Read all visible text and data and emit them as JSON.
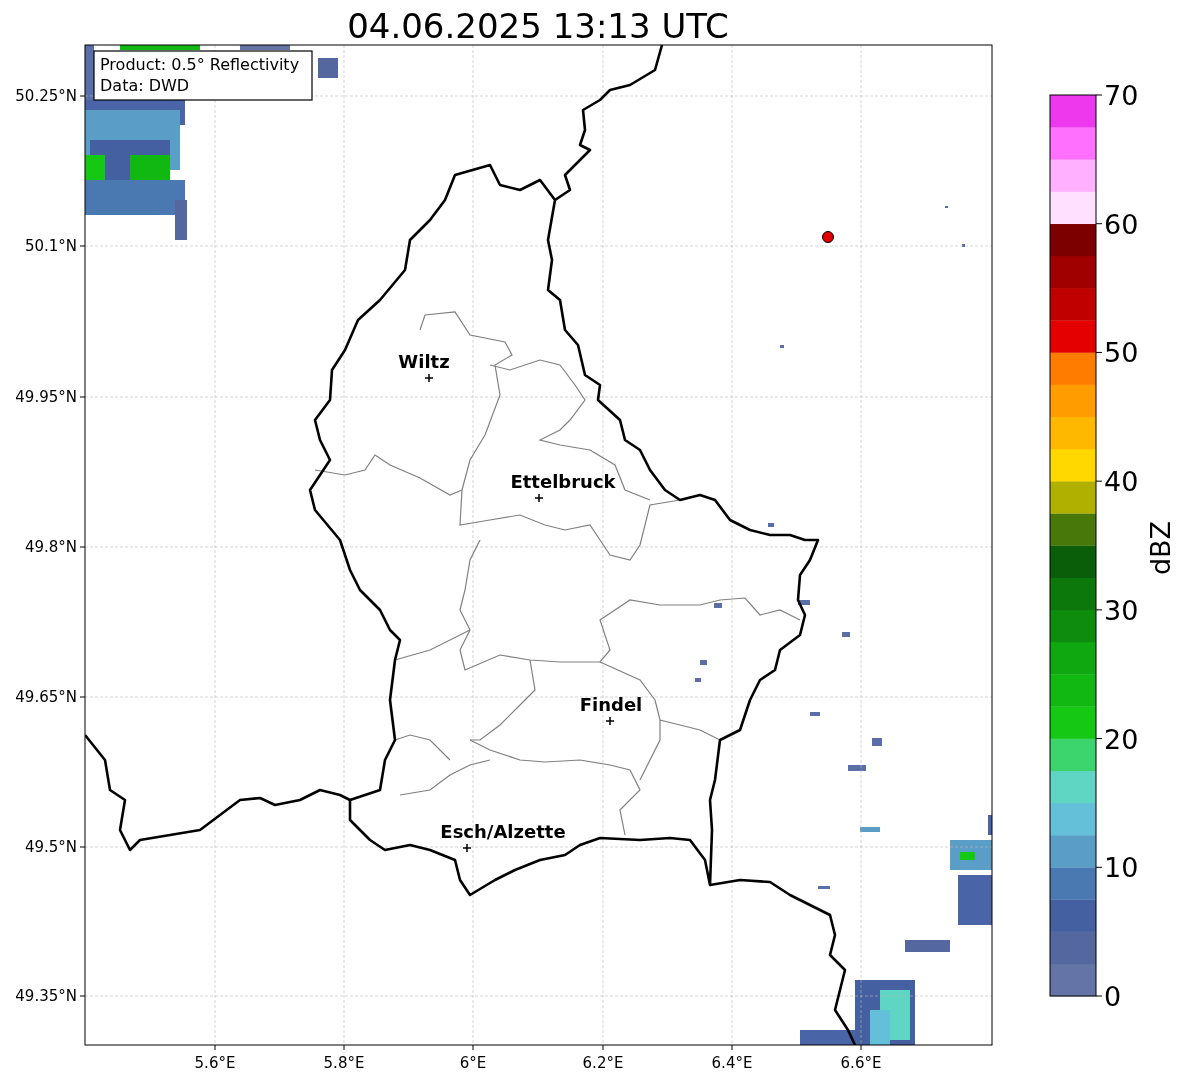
{
  "title": "04.06.2025 13:13 UTC",
  "map": {
    "info_box": [
      "Product: 0.5° Reflectivity",
      "Data: DWD"
    ],
    "y_ticks": [
      "50.25°N",
      "50.1°N",
      "49.95°N",
      "49.8°N",
      "49.65°N",
      "49.5°N",
      "49.35°N"
    ],
    "x_ticks": [
      "5.6°E",
      "5.8°E",
      "6°E",
      "6.2°E",
      "6.4°E",
      "6.6°E"
    ],
    "cities": [
      {
        "name": "Wiltz"
      },
      {
        "name": "Ettelbruck"
      },
      {
        "name": "Findel"
      },
      {
        "name": "Esch/Alzette"
      }
    ]
  },
  "colorbar": {
    "label": "dBZ",
    "ticks": [
      "70",
      "60",
      "50",
      "40",
      "30",
      "20",
      "10",
      "0"
    ],
    "bands": [
      {
        "color": "#6474a6"
      },
      {
        "color": "#55679f"
      },
      {
        "color": "#4560a0"
      },
      {
        "color": "#4a78b0"
      },
      {
        "color": "#5a9ec8"
      },
      {
        "color": "#64c0d8"
      },
      {
        "color": "#5fd6c4"
      },
      {
        "color": "#3cd46c"
      },
      {
        "color": "#14c814"
      },
      {
        "color": "#12b812"
      },
      {
        "color": "#10a810"
      },
      {
        "color": "#0e8c0e"
      },
      {
        "color": "#0c780c"
      },
      {
        "color": "#0a5e0a"
      },
      {
        "color": "#48780a"
      },
      {
        "color": "#b0b000"
      },
      {
        "color": "#ffd800"
      },
      {
        "color": "#ffb800"
      },
      {
        "color": "#ff9c00"
      },
      {
        "color": "#ff7c00"
      },
      {
        "color": "#e40000"
      },
      {
        "color": "#c00000"
      },
      {
        "color": "#a00000"
      },
      {
        "color": "#7c0000"
      },
      {
        "color": "#ffe0ff"
      },
      {
        "color": "#ffb0ff"
      },
      {
        "color": "#ff70ff"
      },
      {
        "color": "#ee38ee"
      }
    ]
  }
}
